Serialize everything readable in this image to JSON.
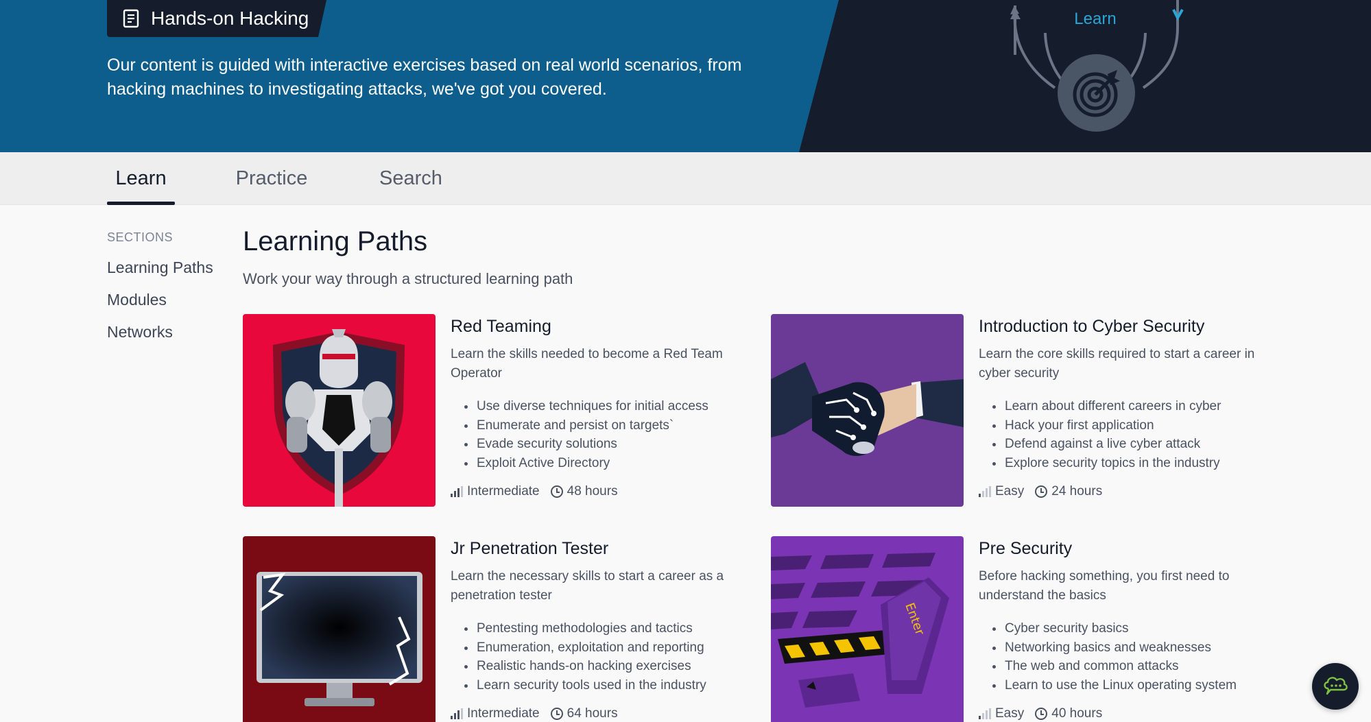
{
  "banner": {
    "title": "Hands-on Hacking",
    "description": "Our content is guided with interactive exercises based on real world scenarios, from hacking machines to investigating attacks, we've got you covered.",
    "cycle_label": "Learn",
    "colors": {
      "blue": "#0d5e8c",
      "navy": "#151c2b",
      "accent": "#2aa6d6"
    }
  },
  "tabs": [
    {
      "label": "Learn",
      "active": true
    },
    {
      "label": "Practice",
      "active": false
    },
    {
      "label": "Search",
      "active": false
    }
  ],
  "sidebar": {
    "heading": "SECTIONS",
    "items": [
      {
        "label": "Learning Paths"
      },
      {
        "label": "Modules"
      },
      {
        "label": "Networks"
      }
    ]
  },
  "main": {
    "title": "Learning Paths",
    "subtitle": "Work your way through a structured learning path",
    "cards": [
      {
        "title": "Red Teaming",
        "description": "Learn the skills needed to become a Red Team Operator",
        "bullets": [
          "Use diverse techniques for initial access",
          "Enumerate and persist on targets`",
          "Evade security solutions",
          "Exploit Active Directory"
        ],
        "level": "Intermediate",
        "level_bars": 3,
        "duration": "48 hours",
        "image_icon": "knight-shield-icon",
        "image_bg": "#e8083c"
      },
      {
        "title": "Introduction to Cyber Security",
        "description": "Learn the core skills required to start a career in cyber security",
        "bullets": [
          "Learn about different careers in cyber",
          "Hack your first application",
          "Defend against a live cyber attack",
          "Explore security topics in the industry"
        ],
        "level": "Easy",
        "level_bars": 1,
        "duration": "24 hours",
        "image_icon": "handshake-icon",
        "image_bg": "#6a3a96"
      },
      {
        "title": "Jr Penetration Tester",
        "description": "Learn the necessary skills to start a career as a penetration tester",
        "bullets": [
          "Pentesting methodologies and tactics",
          "Enumeration, exploitation and reporting",
          "Realistic hands-on hacking exercises",
          "Learn security tools used in the industry"
        ],
        "level": "Intermediate",
        "level_bars": 3,
        "duration": "64 hours",
        "image_icon": "monitor-icon",
        "image_bg": "#7a0a14"
      },
      {
        "title": "Pre Security",
        "description": "Before hacking something, you first need to understand the basics",
        "bullets": [
          "Cyber security basics",
          "Networking basics and weaknesses",
          "The web and common attacks",
          "Learn to use the Linux operating system"
        ],
        "level": "Easy",
        "level_bars": 1,
        "duration": "40 hours",
        "image_icon": "enter-key-icon",
        "image_bg": "#7b34b4",
        "key_label": "Enter"
      }
    ]
  },
  "chat": {
    "icon": "chat-cloud-icon"
  }
}
